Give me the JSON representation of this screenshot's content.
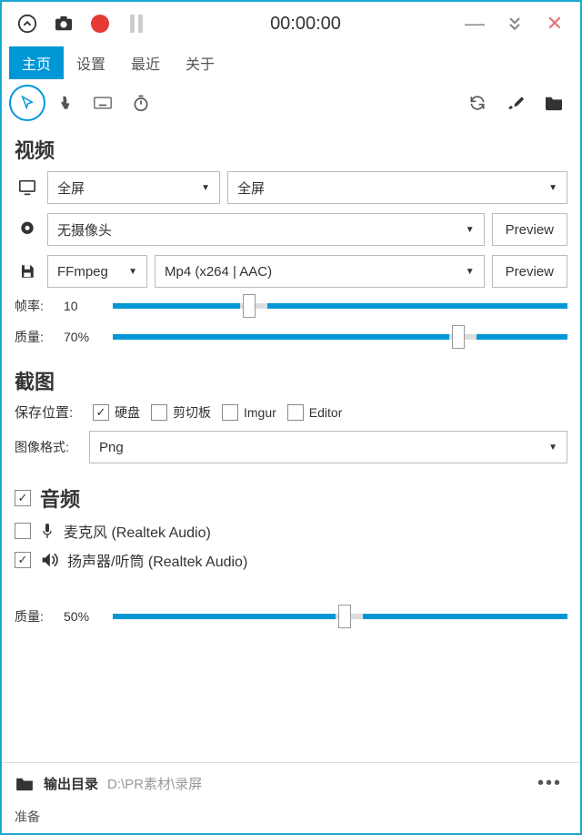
{
  "titlebar": {
    "timer": "00:00:00"
  },
  "tabs": {
    "items": [
      {
        "label": "主页",
        "active": true
      },
      {
        "label": "设置",
        "active": false
      },
      {
        "label": "最近",
        "active": false
      },
      {
        "label": "关于",
        "active": false
      }
    ]
  },
  "video": {
    "heading": "视频",
    "screen_mode": "全屏",
    "screen_target": "全屏",
    "webcam": "无摄像头",
    "preview_label": "Preview",
    "encoder": "FFmpeg",
    "format": "Mp4 (x264 | AAC)",
    "framerate_label": "帧率:",
    "framerate_value": "10",
    "framerate_pct": 28,
    "quality_label": "质量:",
    "quality_value": "70%",
    "quality_pct": 74
  },
  "screenshot": {
    "heading": "截图",
    "save_label": "保存位置:",
    "save_disk": {
      "label": "硬盘",
      "checked": true
    },
    "save_clipboard": {
      "label": "剪切板",
      "checked": false
    },
    "save_imgur": {
      "label": "Imgur",
      "checked": false
    },
    "save_editor": {
      "label": "Editor",
      "checked": false
    },
    "format_label": "图像格式:",
    "format_value": "Png"
  },
  "audio": {
    "enabled": true,
    "heading": "音频",
    "mic": {
      "label": "麦克风 (Realtek Audio)",
      "checked": false
    },
    "speaker": {
      "label": "扬声器/听筒 (Realtek Audio)",
      "checked": true
    },
    "quality_label": "质量:",
    "quality_value": "50%",
    "quality_pct": 50
  },
  "footer": {
    "label": "输出目录",
    "path": "D:\\PR素材\\录屏"
  },
  "status": "准备"
}
